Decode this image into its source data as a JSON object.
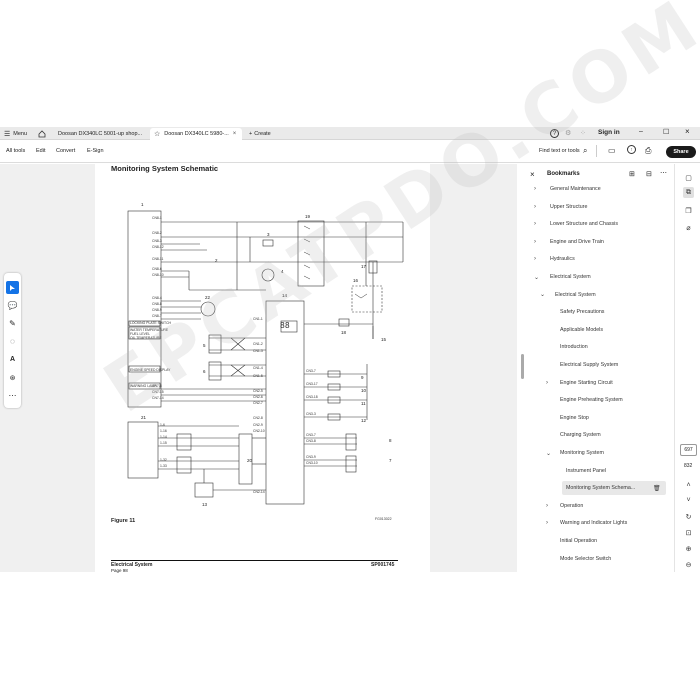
{
  "tabs": [
    {
      "label": "Menu"
    },
    {
      "label": "Doosan DX340LC 5001-up shop..."
    },
    {
      "label": "Doosan DX340LC 5980-..."
    },
    {
      "label": "Create"
    }
  ],
  "header": {
    "sign_in": "Sign in"
  },
  "toolbar": {
    "all_tools": "All tools",
    "edit": "Edit",
    "convert": "Convert",
    "esign": "E-Sign",
    "find": "Find text or tools",
    "share": "Share"
  },
  "document": {
    "title": "Monitoring System Schematic",
    "figure": "Figure 11",
    "footer_left": "Electrical System",
    "footer_right": "SP001745",
    "footer_sub": "Page 98",
    "fig_code": "FG013022",
    "numbers": [
      "1",
      "2",
      "3",
      "4",
      "5",
      "6",
      "7",
      "8",
      "9",
      "10",
      "11",
      "12",
      "13",
      "14",
      "15",
      "16",
      "17",
      "18",
      "19",
      "20",
      "21",
      "22"
    ],
    "box1_labels": [
      "LOCKING PLATE SWITCH",
      "WATER TEMPERATURE FUEL LEVEL OIL TEMPERATURE",
      "ENGINE SPEED DISPLAY",
      "WARNING LAMP"
    ],
    "box14_pins": [
      "CN3-1",
      "CN3-2",
      "CN3-3",
      "CN3-4",
      "CN3-5",
      "CN3-6",
      "CN3-7",
      "CN3-8",
      "CN3-9",
      "CN3-10",
      "CN3-11",
      "CN3-12",
      "CN3-13",
      "CN3-14"
    ]
  },
  "bookmarks": {
    "title": "Bookmarks",
    "items": [
      {
        "label": "General Maintenance",
        "indent": 0,
        "chevron": ">"
      },
      {
        "label": "Upper Structure",
        "indent": 0,
        "chevron": ">"
      },
      {
        "label": "Lower Structure and Chassis",
        "indent": 0,
        "chevron": ">"
      },
      {
        "label": "Engine and Drive Train",
        "indent": 0,
        "chevron": ">"
      },
      {
        "label": "Hydraulics",
        "indent": 0,
        "chevron": ">"
      },
      {
        "label": "Electrical System",
        "indent": 0,
        "chevron": "v"
      },
      {
        "label": "Electrical System",
        "indent": 1,
        "chevron": "v"
      },
      {
        "label": "Safety Precautions",
        "indent": 2,
        "chevron": ""
      },
      {
        "label": "Applicable Models",
        "indent": 2,
        "chevron": ""
      },
      {
        "label": "Introduction",
        "indent": 2,
        "chevron": ""
      },
      {
        "label": "Electrical Supply System",
        "indent": 2,
        "chevron": ""
      },
      {
        "label": "Engine Starting Circuit",
        "indent": 2,
        "chevron": ">"
      },
      {
        "label": "Engine Preheating System",
        "indent": 2,
        "chevron": ""
      },
      {
        "label": "Engine Stop",
        "indent": 2,
        "chevron": ""
      },
      {
        "label": "Charging System",
        "indent": 2,
        "chevron": ""
      },
      {
        "label": "Monitoring System",
        "indent": 2,
        "chevron": "v"
      },
      {
        "label": "Instrument Panel",
        "indent": 3,
        "chevron": ""
      },
      {
        "label": "Monitoring System Schema...",
        "indent": 3,
        "chevron": "",
        "selected": true
      },
      {
        "label": "Operation",
        "indent": 2,
        "chevron": ">"
      },
      {
        "label": "Warning and Indicator Lights",
        "indent": 2,
        "chevron": ">"
      },
      {
        "label": "Initial Operation",
        "indent": 2,
        "chevron": ""
      },
      {
        "label": "Mode Selector Switch",
        "indent": 2,
        "chevron": ""
      }
    ]
  },
  "page_nav": {
    "current": "697",
    "total": "832"
  },
  "watermark": "EPCATPDO.COM",
  "colors": {
    "accent": "#1473e6",
    "share_bg": "#1a1a1a"
  }
}
